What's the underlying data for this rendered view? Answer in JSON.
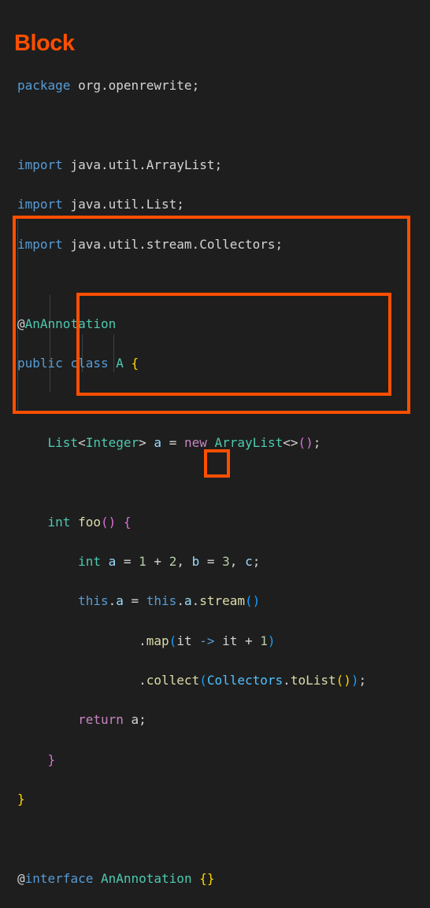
{
  "title": "Block",
  "colors": {
    "highlight": "#ff4f00",
    "background": "#1e1e1e"
  },
  "code": {
    "package_kw": "package",
    "package_name": " org.openrewrite;",
    "imports": [
      {
        "kw": "import",
        "path": " java.util.ArrayList;"
      },
      {
        "kw": "import",
        "path": " java.util.List;"
      },
      {
        "kw": "import",
        "path": " java.util.stream.Collectors;"
      }
    ],
    "annotation_at": "@",
    "annotation_name": "AnAnnotation",
    "class_public": "public",
    "class_kw": " class",
    "class_name": " A",
    "open_brace": "{",
    "field": {
      "type": "List",
      "lt": "<",
      "generic": "Integer",
      "gt": ">",
      "name": "a",
      "eq": " = ",
      "new_kw": "new",
      "ctor": "ArrayList",
      "diamond": "<>",
      "parens": "()",
      "semi": ";"
    },
    "method": {
      "ret_type": "int",
      "name": "foo",
      "parens": "()",
      "brace": "{"
    },
    "stmt1": {
      "kw": "int",
      "a": "a",
      "eq": " = ",
      "n1": "1",
      "plus": " + ",
      "n2": "2",
      "comma1": ", ",
      "b": "b",
      "eq2": " = ",
      "n3": "3",
      "comma2": ", ",
      "c": "c",
      "semi": ";"
    },
    "stmt2": {
      "this1": "this",
      "dot1": ".",
      "a1": "a",
      "eq": " = ",
      "this2": "this",
      "dot2": ".",
      "a2": "a",
      "dot3": ".",
      "stream": "stream",
      "parens": "()"
    },
    "stmt3": {
      "dot": ".",
      "map": "map",
      "lp": "(",
      "it1": "it",
      "arrow": " -> ",
      "it2": "it",
      "plus": " + ",
      "one": "1",
      "rp": ")"
    },
    "stmt4": {
      "dot": ".",
      "collect": "collect",
      "lp": "(",
      "collectors": "Collectors",
      "dot2": ".",
      "tolist": "toList",
      "inner": "()",
      "rp": ")",
      "semi": ";"
    },
    "ret": {
      "kw": "return",
      "val": " a;"
    },
    "method_close": "}",
    "class_close": "}",
    "iface_at": "@",
    "iface_kw": "interface",
    "iface_name": " AnAnnotation ",
    "iface_body": "{}"
  }
}
